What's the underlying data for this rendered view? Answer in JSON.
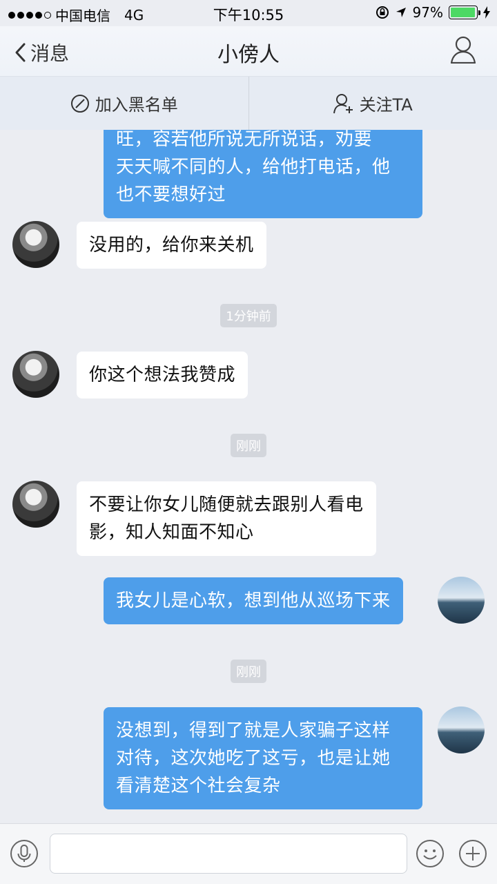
{
  "status_bar": {
    "carrier": "中国电信",
    "network": "4G",
    "time": "下午10:55",
    "battery": "97%",
    "battery_level": 0.97,
    "battery_color": "#4cd964"
  },
  "nav": {
    "back_label": "消息",
    "title": "小傍人",
    "profile_icon": "person-icon"
  },
  "actions": {
    "blacklist_label": "加入黑名单",
    "follow_label": "关注TA"
  },
  "messages": [
    {
      "type": "out",
      "text_lines": [
        "旺，容若他所说无所说话，劝要",
        "天天喊不同的人，给他打电话，他",
        "也不要想好过"
      ]
    },
    {
      "type": "in",
      "text": "没用的，给你来关机"
    },
    {
      "type": "time",
      "text": "1分钟前"
    },
    {
      "type": "in",
      "text": "你这个想法我赞成"
    },
    {
      "type": "time",
      "text": "刚刚"
    },
    {
      "type": "in",
      "text_lines": [
        "不要让你女儿随便就去跟别人看电",
        "影，知人知面不知心"
      ]
    },
    {
      "type": "out",
      "text": "我女儿是心软，想到他从巡场下来"
    },
    {
      "type": "time",
      "text": "刚刚"
    },
    {
      "type": "out",
      "text_lines": [
        "没想到，得到了就是人家骗子这样",
        "对待，这次她吃了这亏，也是让她",
        "看清楚这个社会复杂"
      ]
    }
  ],
  "input": {
    "placeholder": ""
  },
  "colors": {
    "outgoing_bubble": "#4e9eea",
    "incoming_bubble": "#ffffff",
    "background": "#ebedf2"
  }
}
